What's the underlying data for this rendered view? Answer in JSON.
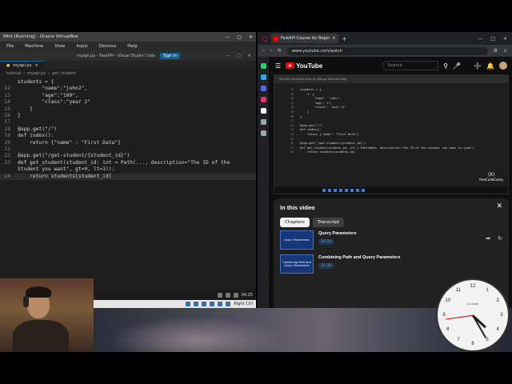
{
  "vbox": {
    "title": "Mint [Running] - Oracle VirtualBox",
    "menu": [
      "File",
      "Machine",
      "View",
      "Input",
      "Devices",
      "Help"
    ],
    "status_right": "Right Ctrl"
  },
  "vscode": {
    "title": "myapi.py - FastAPI - Visual Studio Code",
    "sign_in": "Sign in",
    "tab": "myapi.py",
    "breadcrumbs": [
      "tutorial",
      "myapi.py",
      "get_student"
    ],
    "taskbar_time": "04:25"
  },
  "code_lines": [
    {
      "n": "",
      "t": "students = {"
    },
    {
      "n": "12",
      "t": "        \"name\":\"john2\","
    },
    {
      "n": "13",
      "t": "        \"age\":\"180\","
    },
    {
      "n": "14",
      "t": "        \"class\":\"year 2\""
    },
    {
      "n": "15",
      "t": "    }"
    },
    {
      "n": "16",
      "t": "}"
    },
    {
      "n": "17",
      "t": ""
    },
    {
      "n": "18",
      "t": "@app.get(\"/\")"
    },
    {
      "n": "19",
      "t": "def index():"
    },
    {
      "n": "20",
      "t": "    return {\"name\" : \"First Data\"}"
    },
    {
      "n": "21",
      "t": ""
    },
    {
      "n": "22",
      "t": "@app.get(\"/get-student/{student_id}\")"
    },
    {
      "n": "23",
      "t": "def get_student(student_id: int = Path(..., description=\"The ID of the"
    },
    {
      "n": "",
      "t": "Student you want\", gt=0, lt=3)):"
    },
    {
      "n": "24",
      "t": "    return students[student_id]"
    }
  ],
  "browser": {
    "tab_title": "FastAPI Course for Begin",
    "url": "www.youtube.com/watch"
  },
  "youtube": {
    "logo": "YouTube",
    "search_placeholder": "Search",
    "panel_title": "In this video",
    "chip_chapters": "Chapters",
    "chip_transcript": "Transcript",
    "chapters": [
      {
        "title": "Query Parameters",
        "time": "37:24",
        "thumb": "Query Parameters"
      },
      {
        "title": "Combining Path and Query Parameters",
        "time": "37:36",
        "thumb": "Combining Path and Query Parameters"
      }
    ]
  },
  "video_code_lines": [
    {
      "n": "14",
      "t": "students = {"
    },
    {
      "n": "15",
      "t": "    1: {"
    },
    {
      "n": "16",
      "t": "        \"name\": \"john\","
    },
    {
      "n": "17",
      "t": "        \"age\": 17,"
    },
    {
      "n": "18",
      "t": "        \"class\": \"year 12\""
    },
    {
      "n": "19",
      "t": "    }"
    },
    {
      "n": "20",
      "t": "}"
    },
    {
      "n": "21",
      "t": ""
    },
    {
      "n": "22",
      "t": "@app.get(\"/\")"
    },
    {
      "n": "23",
      "t": "def index():"
    },
    {
      "n": "24",
      "t": "    return {\"name\": \"First Data\"}"
    },
    {
      "n": "25",
      "t": ""
    },
    {
      "n": "26",
      "t": "@app.get(\"/get-student/{student_id}\")"
    },
    {
      "n": "27",
      "t": "def get_student(student_id: int = Path(None, description=\"The ID of the student you want to view\")"
    },
    {
      "n": "28",
      "t": "    return students[student_id]"
    }
  ],
  "clock": {
    "numbers": [
      "12",
      "1",
      "2",
      "3",
      "4",
      "5",
      "6",
      "7",
      "8",
      "9",
      "10",
      "11"
    ],
    "brand": "A.Lange",
    "time": "4:25"
  }
}
